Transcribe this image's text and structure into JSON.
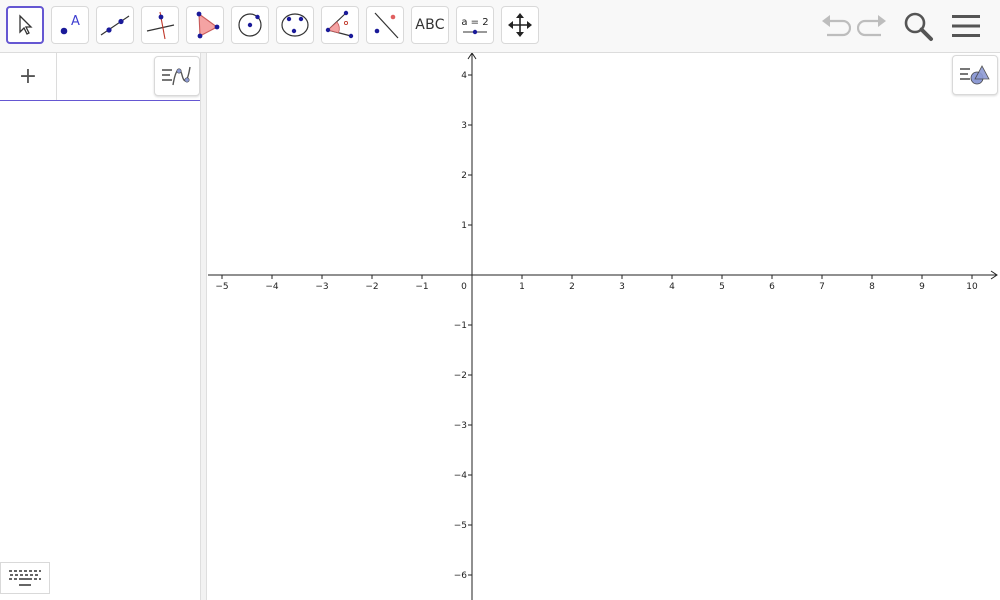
{
  "toolbar": {
    "tools": [
      {
        "name": "move-tool",
        "icon": "pointer-arrow-icon"
      },
      {
        "name": "point-tool",
        "icon": "point-icon",
        "label": "A"
      },
      {
        "name": "line-tool",
        "icon": "line-through-points-icon"
      },
      {
        "name": "perpendicular-line-tool",
        "icon": "perpendicular-line-icon"
      },
      {
        "name": "polygon-tool",
        "icon": "polygon-icon"
      },
      {
        "name": "circle-center-point-tool",
        "icon": "circle-center-icon"
      },
      {
        "name": "circle-three-points-tool",
        "icon": "circle-three-points-icon"
      },
      {
        "name": "angle-tool",
        "icon": "angle-icon"
      },
      {
        "name": "reflect-tool",
        "icon": "reflect-about-line-icon"
      },
      {
        "name": "text-tool",
        "icon": "text-icon",
        "label": "ABC"
      },
      {
        "name": "slider-tool",
        "icon": "slider-icon",
        "label": "a = 2"
      },
      {
        "name": "move-graphics-view-tool",
        "icon": "move-cross-arrows-icon"
      }
    ],
    "selected_tool": "move-tool",
    "right": {
      "undo": "undo-icon",
      "redo": "redo-icon",
      "search": "search-icon",
      "menu": "hamburger-menu-icon"
    }
  },
  "algebra": {
    "add_label": "+",
    "style_bar_icon": "algebra-style-bar-icon",
    "keyboard_icon": "keyboard-icon"
  },
  "graphics": {
    "style_bar_icon": "graphics-style-bar-icon",
    "x_ticks": [
      "−5",
      "−4",
      "−3",
      "−2",
      "−1",
      "0",
      "1",
      "2",
      "3",
      "4",
      "5",
      "6",
      "7",
      "8",
      "9",
      "10"
    ],
    "y_ticks_positive": [
      "4",
      "3",
      "2",
      "1"
    ],
    "y_ticks_negative": [
      "−1",
      "−2",
      "−3",
      "−4",
      "−5",
      "−6"
    ]
  },
  "colors": {
    "accent": "#6557d2",
    "point": "#1a1a99",
    "polygon_fill": "#f4a3a3",
    "polygon_stroke": "#c85b5b"
  }
}
